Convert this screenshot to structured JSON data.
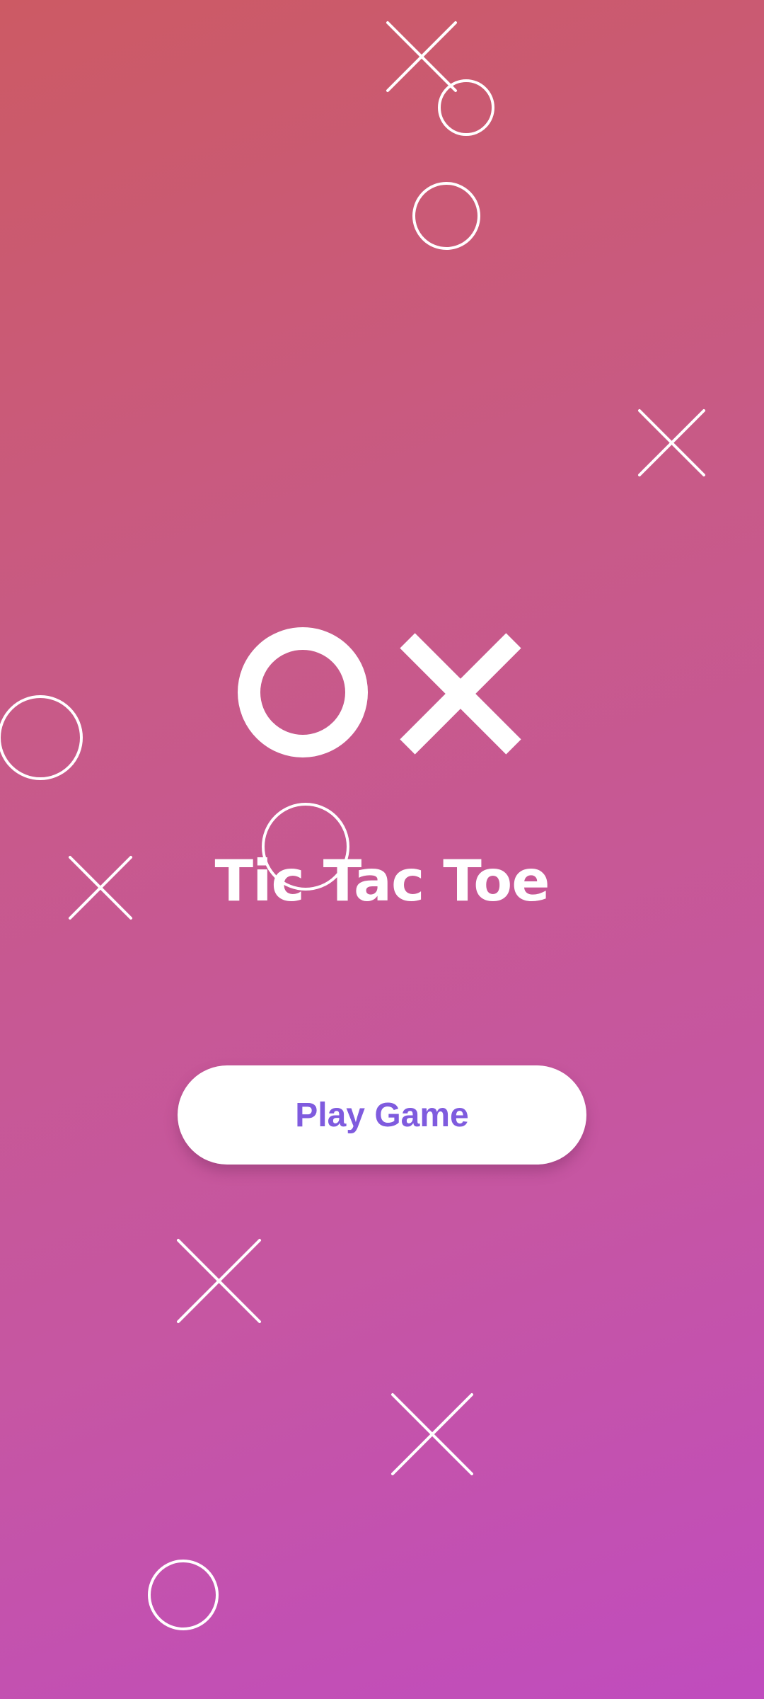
{
  "game": {
    "title": "Tic Tac Toe",
    "play_label": "Play Game"
  },
  "colors": {
    "background_top": "#cc5a64",
    "background_bottom": "#c04cbe",
    "button_text": "#7f5bde",
    "foreground": "#ffffff"
  },
  "icons": {
    "logo_o": "circle-o-icon",
    "logo_x": "cross-x-icon"
  }
}
